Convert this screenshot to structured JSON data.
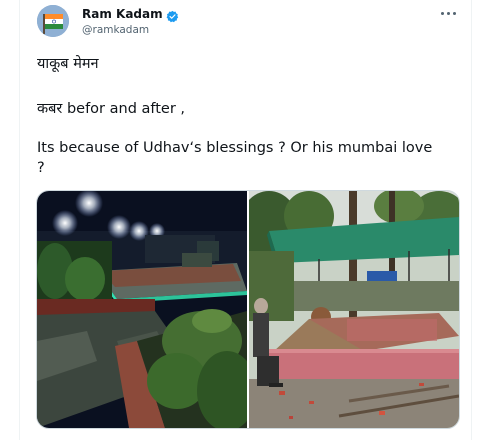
{
  "tweet": {
    "author": {
      "display_name": "Ram Kadam",
      "handle": "@ramkadam",
      "verified": true,
      "avatar_icon": "india-flag-icon"
    },
    "menu_icon": "more-horizontal-icon",
    "lines": [
      "याकूब मेमन",
      "कबर befor and after ,",
      " Its because of Udhav‘s blessings ? Or his mumbai love",
      "?"
    ],
    "media": [
      {
        "name": "grave-after-photo"
      },
      {
        "name": "grave-before-photo"
      }
    ]
  },
  "colors": {
    "text": "#0f1419",
    "secondary_text": "#536471",
    "verified_badge": "#1d9bf0",
    "border": "#cfd9de"
  }
}
